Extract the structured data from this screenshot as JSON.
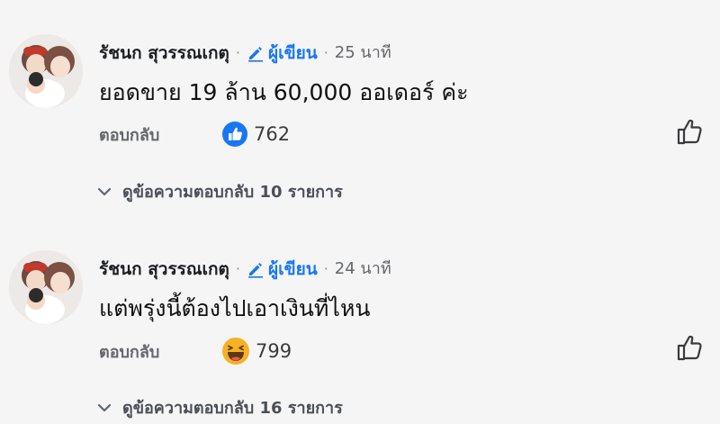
{
  "comments": [
    {
      "author": "รัชนก สุวรรณเกตุ",
      "badge": "ผู้เขียน",
      "time": "25 นาที",
      "text": "ยอดขาย 19 ล้าน 60,000 ออเดอร์ ค่ะ",
      "reply_label": "ตอบกลับ",
      "reaction_icon": "like-icon",
      "reaction_count": "762",
      "view_replies": "ดูข้อความตอบกลับ 10 รายการ"
    },
    {
      "author": "รัชนก สุวรรณเกตุ",
      "badge": "ผู้เขียน",
      "time": "24 นาที",
      "text": "แต่พรุ่งนี้ต้องไปเอาเงินที่ไหน",
      "reply_label": "ตอบกลับ",
      "reaction_icon": "haha-icon",
      "reaction_count": "799",
      "view_replies": "ดูข้อความตอบกลับ 16 รายการ"
    }
  ],
  "colors": {
    "accent": "#1877f2",
    "muted": "#65676b",
    "haha": "#f7b125"
  }
}
